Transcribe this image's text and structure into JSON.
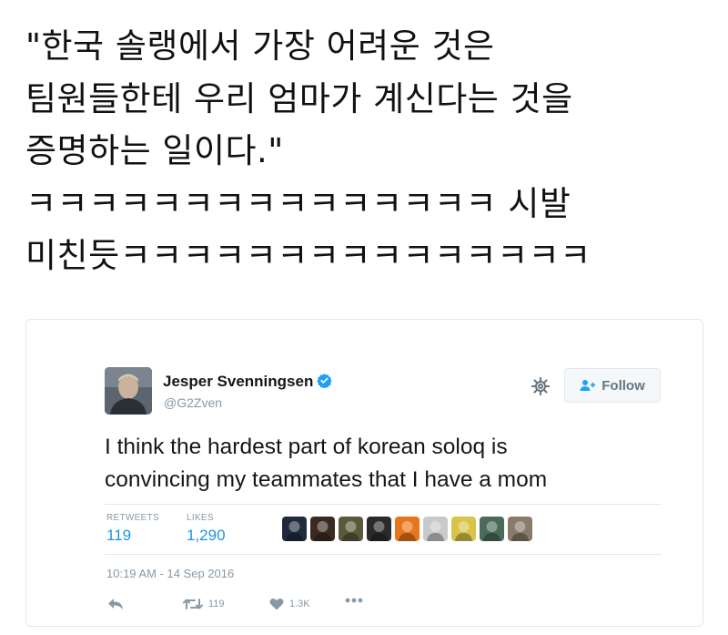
{
  "caption": {
    "lines": [
      "\"한국 솔랭에서 가장 어려운 것은",
      "팀원들한테 우리 엄마가 계신다는 것을",
      "증명하는 일이다.\"",
      "ㅋㅋㅋㅋㅋㅋㅋㅋㅋㅋㅋㅋㅋㅋㅋ 시발",
      "미친듯ㅋㅋㅋㅋㅋㅋㅋㅋㅋㅋㅋㅋㅋㅋㅋ"
    ]
  },
  "tweet": {
    "author": {
      "name": "Jesper Svenningsen",
      "handle": "@G2Zven",
      "verified": true
    },
    "follow_label": "Follow",
    "text_lines": [
      "I think the hardest part of korean soloq is",
      "convincing my teammates that I have a mom"
    ],
    "stats": {
      "retweets_label": "RETWEETS",
      "retweets_value": "119",
      "likes_label": "LIKES",
      "likes_value": "1,290"
    },
    "liker_avatar_colors": [
      "#1f2a3a",
      "#3a2a22",
      "#5a5a3a",
      "#2a2a2a",
      "#e8751a",
      "#c9c9c9",
      "#d9c44a",
      "#4a6a5a",
      "#8a7a6a"
    ],
    "timestamp": "10:19 AM - 14 Sep 2016",
    "actions": {
      "reply_icon": "reply-icon",
      "retweet_count": "119",
      "like_count": "1.3K",
      "more_icon": "more-icon"
    }
  },
  "colors": {
    "accent": "#1b95e0",
    "muted": "#8899a6",
    "border": "#e1e8ed",
    "verified": "#1da1f2"
  }
}
